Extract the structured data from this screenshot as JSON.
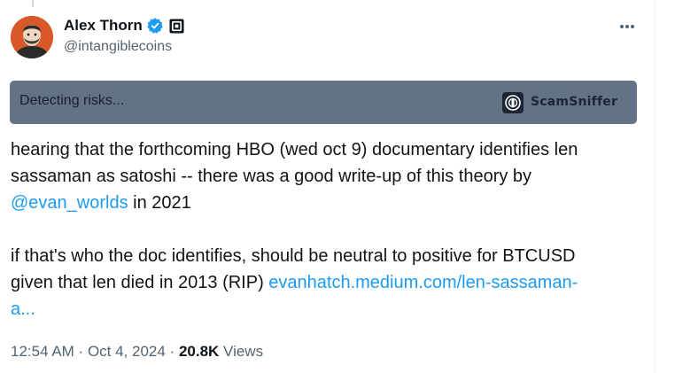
{
  "author": {
    "display_name": "Alex Thorn",
    "handle": "@intangiblecoins",
    "verified": true,
    "avatar_icon": "avatar-portrait"
  },
  "risk_banner": {
    "text": "Detecting risks...",
    "brand": "ScamSniffer",
    "background": "#637287"
  },
  "tweet": {
    "line1": "hearing that the forthcoming HBO (wed oct 9) documentary identifies len",
    "line2": "sassaman as satoshi -- there was a good write-up of this theory by",
    "mention": "@evan_worlds",
    "line3_suffix": " in 2021",
    "line4": "if that's who the doc identifies, should be neutral to positive for BTCUSD",
    "line5_prefix": "given that len died in 2013 (RIP) ",
    "link_part1": "evanhatch.medium.com/len-sassaman-",
    "link_part2": "a..."
  },
  "meta": {
    "time": "12:54 AM",
    "separator": " · ",
    "date": "Oct 4, 2024",
    "views_count": "20.8K",
    "views_label": " Views"
  },
  "colors": {
    "link": "#1d9bf0",
    "muted": "#536471",
    "verified": "#1d9bf0"
  }
}
